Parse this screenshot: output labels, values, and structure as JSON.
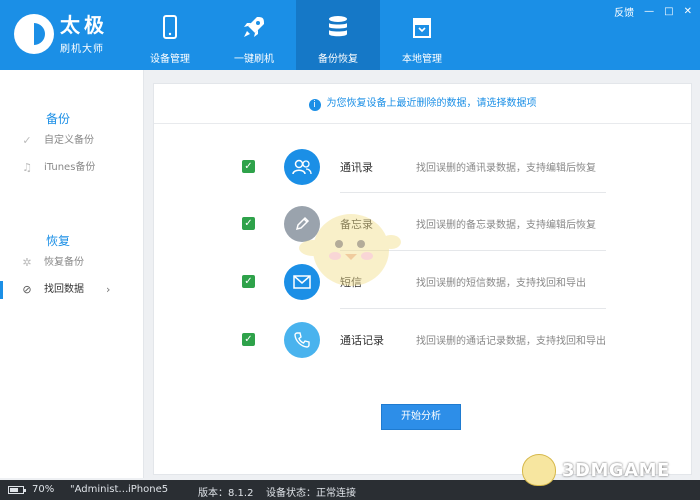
{
  "app": {
    "logo_title": "太极",
    "logo_subtitle": "刷机大师"
  },
  "nav": [
    {
      "label": "设备管理",
      "icon": "phone-icon",
      "active": false
    },
    {
      "label": "一键刷机",
      "icon": "rocket-icon",
      "active": false
    },
    {
      "label": "备份恢复",
      "icon": "database-icon",
      "active": true
    },
    {
      "label": "本地管理",
      "icon": "box-icon",
      "active": false
    }
  ],
  "window": {
    "feedback": "反馈",
    "minimize": "—",
    "maximize": "□",
    "close": "✕"
  },
  "sidebar": {
    "backup_title": "备份",
    "backup_items": [
      {
        "label": "自定义备份",
        "icon": "check-icon"
      },
      {
        "label": "iTunes备份",
        "icon": "music-note-icon"
      }
    ],
    "restore_title": "恢复",
    "restore_items": [
      {
        "label": "恢复备份",
        "icon": "gear-icon"
      },
      {
        "label": "找回数据",
        "icon": "clock-icon",
        "active": true,
        "chevron": "›"
      }
    ]
  },
  "main": {
    "notice": "为您恢复设备上最近删除的数据，请选择数据项",
    "items": [
      {
        "name": "通讯录",
        "desc": "找回误删的通讯录数据，支持编辑后恢复",
        "icon": "contacts-icon",
        "checked": true
      },
      {
        "name": "备忘录",
        "desc": "找回误删的备忘录数据，支持编辑后恢复",
        "icon": "pencil-icon",
        "checked": true
      },
      {
        "name": "短信",
        "desc": "找回误删的短信数据，支持找回和导出",
        "icon": "envelope-icon",
        "checked": true
      },
      {
        "name": "通话记录",
        "desc": "找回误删的通话记录数据，支持找回和导出",
        "icon": "phone-handset-icon",
        "checked": true
      }
    ],
    "start_button": "开始分析"
  },
  "status": {
    "battery": "70%",
    "battery_level": 0.7,
    "user": "\"Administ…",
    "device": "iPhone5",
    "version": "版本：8.1.2",
    "device_state": "设备状态：正常连接"
  },
  "watermark": {
    "text": "3DMGAME"
  },
  "colors": {
    "primary": "#1b8fe6",
    "primary_dark": "#1578c7",
    "check_green": "#2ea24a",
    "statusbar": "#2a2e33"
  }
}
